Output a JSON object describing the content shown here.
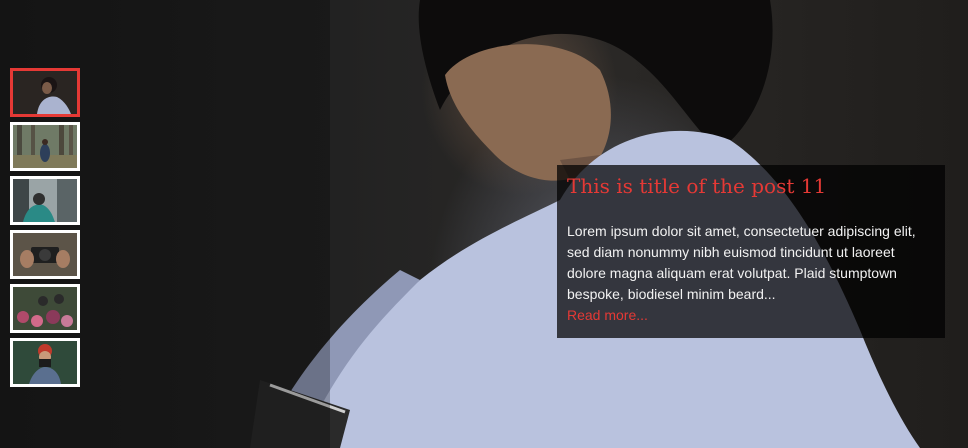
{
  "slide": {
    "title": "This is title of the post 11",
    "excerpt": "Lorem ipsum dolor sit amet, consectetuer adipiscing elit, sed diam nonummy nibh euismod tincidunt ut laoreet dolore magna aliquam erat volutpat. Plaid stumptown bespoke, biodiesel minim beard...",
    "read_more": "Read more...",
    "image": "woman-reading-photo"
  },
  "thumbnails": [
    {
      "image": "woman-reading-thumb",
      "active": true
    },
    {
      "image": "forest-walker-thumb",
      "active": false
    },
    {
      "image": "street-photographer-thumb",
      "active": false
    },
    {
      "image": "camera-hands-thumb",
      "active": false
    },
    {
      "image": "flower-crowd-thumb",
      "active": false
    },
    {
      "image": "red-haired-photographer-thumb",
      "active": false
    }
  ],
  "colors": {
    "accent": "#e53935",
    "caption_bg": "rgba(0,0,0,0.72)",
    "text": "#f2f2f2"
  }
}
